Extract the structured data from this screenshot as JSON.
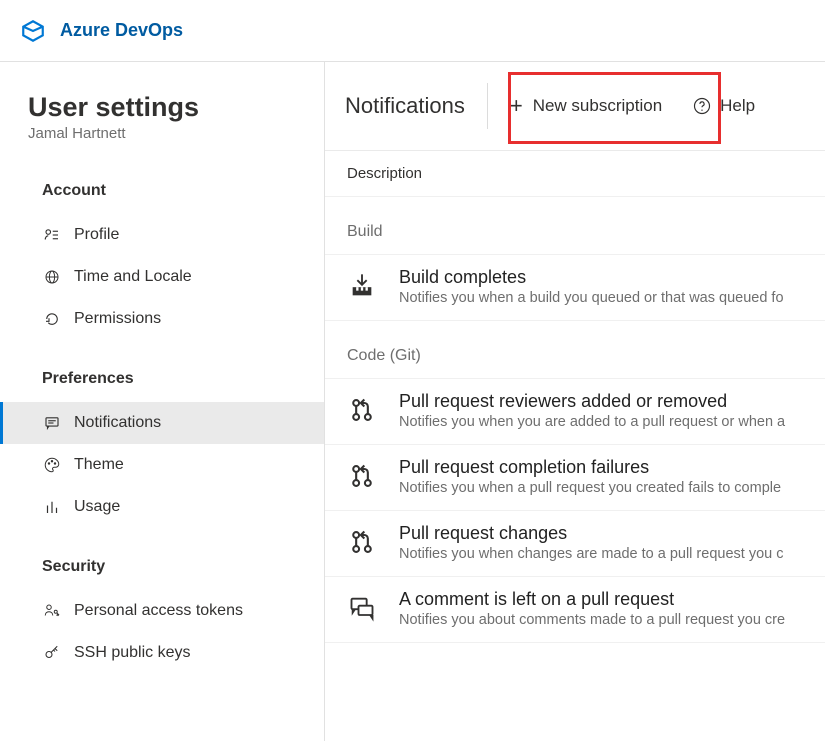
{
  "brand": "Azure DevOps",
  "page_title": "User settings",
  "user_name": "Jamal Hartnett",
  "sections": {
    "account": {
      "heading": "Account",
      "profile": "Profile",
      "time_locale": "Time and Locale",
      "permissions": "Permissions"
    },
    "preferences": {
      "heading": "Preferences",
      "notifications": "Notifications",
      "theme": "Theme",
      "usage": "Usage"
    },
    "security": {
      "heading": "Security",
      "pat": "Personal access tokens",
      "ssh": "SSH public keys"
    }
  },
  "toolbar": {
    "title": "Notifications",
    "new_subscription": "New subscription",
    "help": "Help"
  },
  "columns": {
    "description": "Description"
  },
  "groups": {
    "build": "Build",
    "code_git": "Code (Git)"
  },
  "rows": {
    "build_completes": {
      "title": "Build completes",
      "sub": "Notifies you when a build you queued or that was queued fo"
    },
    "pr_reviewers": {
      "title": "Pull request reviewers added or removed",
      "sub": "Notifies you when you are added to a pull request or when a"
    },
    "pr_fail": {
      "title": "Pull request completion failures",
      "sub": "Notifies you when a pull request you created fails to comple"
    },
    "pr_changes": {
      "title": "Pull request changes",
      "sub": "Notifies you when changes are made to a pull request you c"
    },
    "pr_comment": {
      "title": "A comment is left on a pull request",
      "sub": "Notifies you about comments made to a pull request you cre"
    }
  }
}
